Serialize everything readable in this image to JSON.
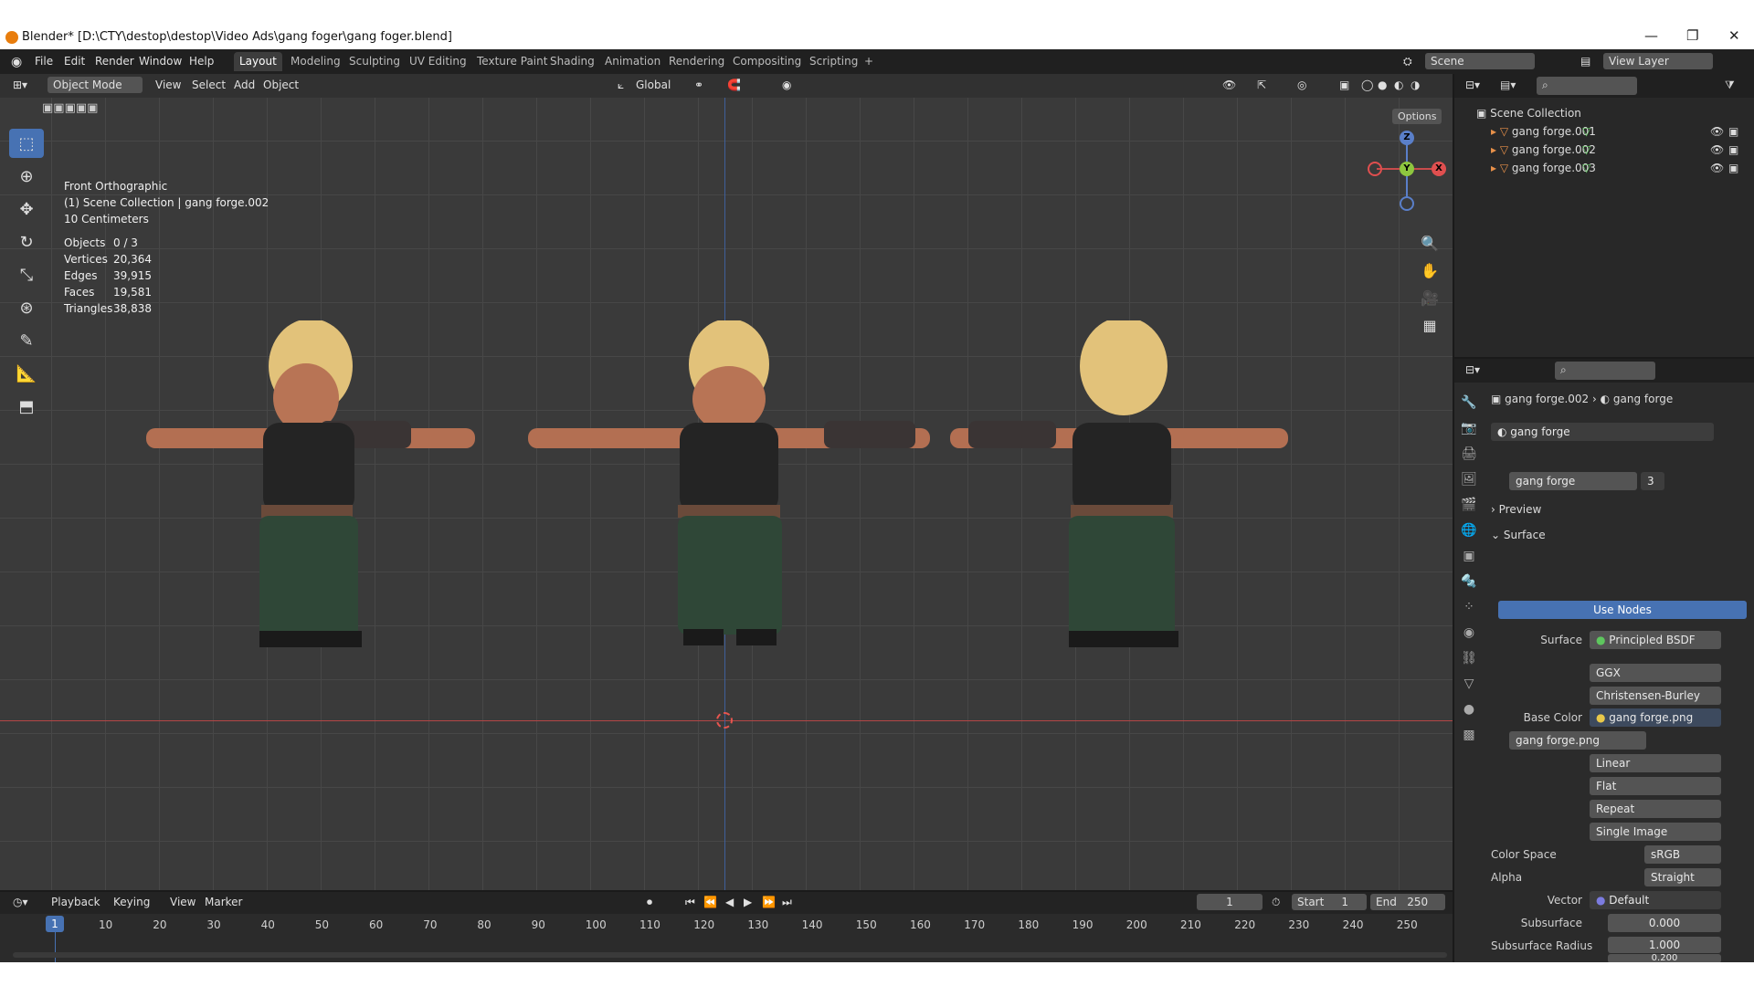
{
  "window": {
    "title": "Blender* [D:\\CTY\\destop\\destop\\Video Ads\\gang foger\\gang  foger.blend]",
    "minimize": "—",
    "maximize": "❐",
    "close": "✕"
  },
  "menu": [
    "File",
    "Edit",
    "Render",
    "Window",
    "Help"
  ],
  "workspaces": [
    "Layout",
    "Modeling",
    "Sculpting",
    "UV Editing",
    "Texture Paint",
    "Shading",
    "Animation",
    "Rendering",
    "Compositing",
    "Scripting"
  ],
  "add_workspace": "+",
  "scene": {
    "label": "Scene",
    "view_layer": "View Layer"
  },
  "viewport_header": {
    "mode": "Object Mode",
    "view": "View",
    "select": "Select",
    "add": "Add",
    "object": "Object",
    "orientation": "Global",
    "options": "Options"
  },
  "viewport_info": {
    "line1": "Front Orthographic",
    "line2": "(1) Scene Collection | gang forge.002",
    "line3": "10 Centimeters"
  },
  "stats": [
    {
      "k": "Objects",
      "v": "0 / 3"
    },
    {
      "k": "Vertices",
      "v": "20,364"
    },
    {
      "k": "Edges",
      "v": "39,915"
    },
    {
      "k": "Faces",
      "v": "19,581"
    },
    {
      "k": "Triangles",
      "v": "38,838"
    }
  ],
  "gizmo": {
    "z": "Z",
    "y": "Y",
    "x": "X"
  },
  "outliner": {
    "root": "Scene Collection",
    "items": [
      "gang forge.001",
      "gang forge.002",
      "gang forge.003"
    ]
  },
  "properties": {
    "breadcrumb_object": "gang forge.002",
    "breadcrumb_material": "gang forge",
    "material_slot": "gang forge",
    "material_name": "gang forge",
    "users": "3",
    "preview": "Preview",
    "surface_section": "Surface",
    "use_nodes": "Use Nodes",
    "surface_label": "Surface",
    "surface_value": "Principled BSDF",
    "distribution": "GGX",
    "subsurface_method": "Christensen-Burley",
    "base_color_label": "Base Color",
    "base_color_value": "gang forge.png",
    "image_name": "gang forge.png",
    "interpolation": "Linear",
    "projection": "Flat",
    "extension": "Repeat",
    "source": "Single Image",
    "color_space_label": "Color Space",
    "color_space_value": "sRGB",
    "alpha_label": "Alpha",
    "alpha_value": "Straight",
    "vector_label": "Vector",
    "vector_value": "Default",
    "subsurface_label": "Subsurface",
    "subsurface_value": "0.000",
    "subsurface_radius_label": "Subsurface Radius",
    "subsurface_radius_1": "1.000",
    "subsurface_radius_2": "0.200"
  },
  "timeline": {
    "playback": "Playback",
    "keying": "Keying",
    "view": "View",
    "marker": "Marker",
    "current_frame": "1",
    "start_label": "Start",
    "start_value": "1",
    "end_label": "End",
    "end_value": "250",
    "ticks": [
      "10",
      "20",
      "30",
      "40",
      "50",
      "60",
      "70",
      "80",
      "90",
      "100",
      "110",
      "120",
      "130",
      "140",
      "150",
      "160",
      "170",
      "180",
      "190",
      "200",
      "210",
      "220",
      "230",
      "240",
      "250"
    ],
    "cursor": "1"
  }
}
